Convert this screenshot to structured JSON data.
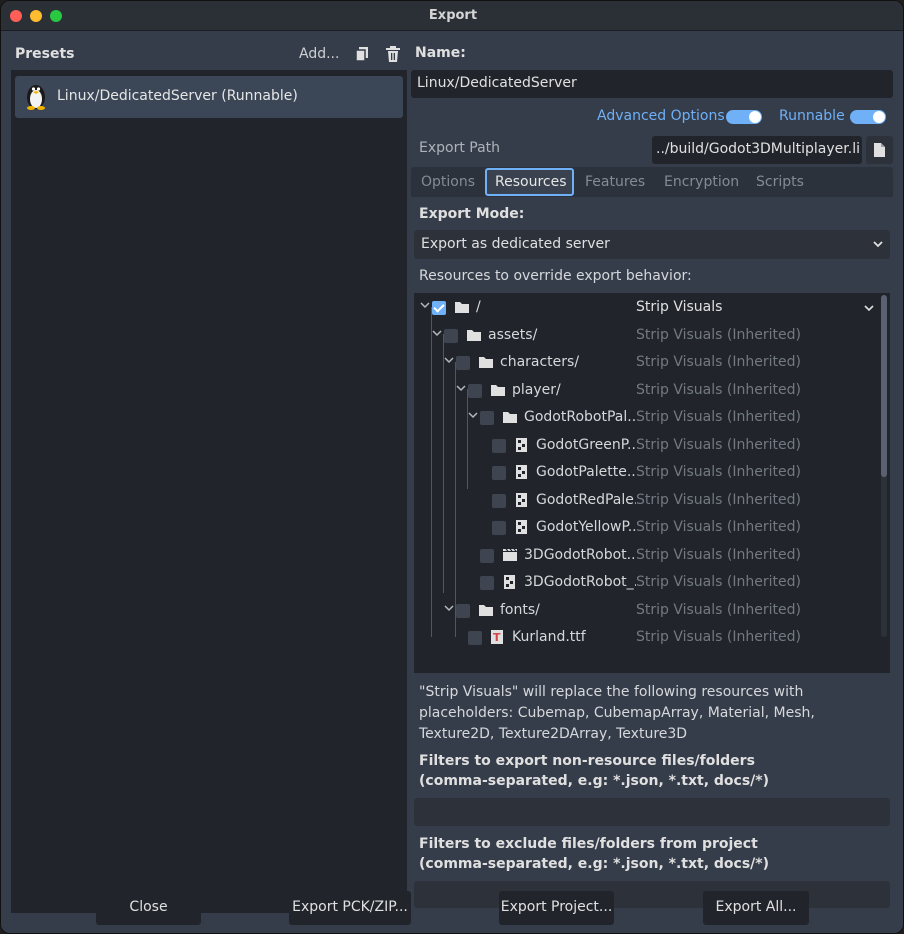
{
  "window": {
    "title": "Export"
  },
  "presets": {
    "header": "Presets",
    "add_label": "Add...",
    "items": [
      {
        "label": "Linux/DedicatedServer (Runnable)",
        "icon": "linux-icon"
      }
    ]
  },
  "details": {
    "name_label": "Name:",
    "name_value": "Linux/DedicatedServer",
    "advanced_options_label": "Advanced Options",
    "advanced_options_on": true,
    "runnable_label": "Runnable",
    "runnable_on": true,
    "export_path_label": "Export Path",
    "export_path_value": "../build/Godot3DMultiplayer.li"
  },
  "tabs": [
    "Options",
    "Resources",
    "Features",
    "Encryption",
    "Scripts"
  ],
  "active_tab": "Resources",
  "resources": {
    "export_mode_label": "Export Mode:",
    "export_mode_value": "Export as dedicated server",
    "override_label": "Resources to override export behavior:",
    "tree": [
      {
        "name": "/",
        "mode": "Strip Visuals",
        "checked": true,
        "icon": "folder-icon"
      },
      {
        "name": "assets/",
        "mode": "Strip Visuals (Inherited)",
        "checked": false,
        "icon": "folder-icon"
      },
      {
        "name": "characters/",
        "mode": "Strip Visuals (Inherited)",
        "checked": false,
        "icon": "folder-icon"
      },
      {
        "name": "player/",
        "mode": "Strip Visuals (Inherited)",
        "checked": false,
        "icon": "folder-icon"
      },
      {
        "name": "GodotRobotPal...",
        "mode": "Strip Visuals (Inherited)",
        "checked": false,
        "icon": "folder-icon"
      },
      {
        "name": "GodotGreenP...",
        "mode": "Strip Visuals (Inherited)",
        "checked": false,
        "icon": "texture-icon"
      },
      {
        "name": "GodotPalette...",
        "mode": "Strip Visuals (Inherited)",
        "checked": false,
        "icon": "texture-icon"
      },
      {
        "name": "GodotRedPale...",
        "mode": "Strip Visuals (Inherited)",
        "checked": false,
        "icon": "texture-icon"
      },
      {
        "name": "GodotYellowP...",
        "mode": "Strip Visuals (Inherited)",
        "checked": false,
        "icon": "texture-icon"
      },
      {
        "name": "3DGodotRobot...",
        "mode": "Strip Visuals (Inherited)",
        "checked": false,
        "icon": "scene-icon"
      },
      {
        "name": "3DGodotRobot_...",
        "mode": "Strip Visuals (Inherited)",
        "checked": false,
        "icon": "texture-icon"
      },
      {
        "name": "fonts/",
        "mode": "Strip Visuals (Inherited)",
        "checked": false,
        "icon": "folder-icon"
      },
      {
        "name": "Kurland.ttf",
        "mode": "Strip Visuals (Inherited)",
        "checked": false,
        "icon": "font-icon"
      }
    ],
    "strip_note": "\"Strip Visuals\" will replace the following resources with placeholders: Cubemap, CubemapArray, Material, Mesh, Texture2D, Texture2DArray, Texture3D",
    "include_filter_title": "Filters to export non-resource files/folders",
    "include_filter_hint": "(comma-separated, e.g: *.json, *.txt, docs/*)",
    "include_filter_value": "",
    "exclude_filter_title": "Filters to exclude files/folders from project",
    "exclude_filter_hint": "(comma-separated, e.g: *.json, *.txt, docs/*)",
    "exclude_filter_value": ""
  },
  "footer": {
    "close": "Close",
    "export_pck": "Export PCK/ZIP...",
    "export_project": "Export Project...",
    "export_all": "Export All..."
  },
  "colors": {
    "accent": "#6fb0f7",
    "panel": "#363d4a",
    "field": "#21252b"
  }
}
